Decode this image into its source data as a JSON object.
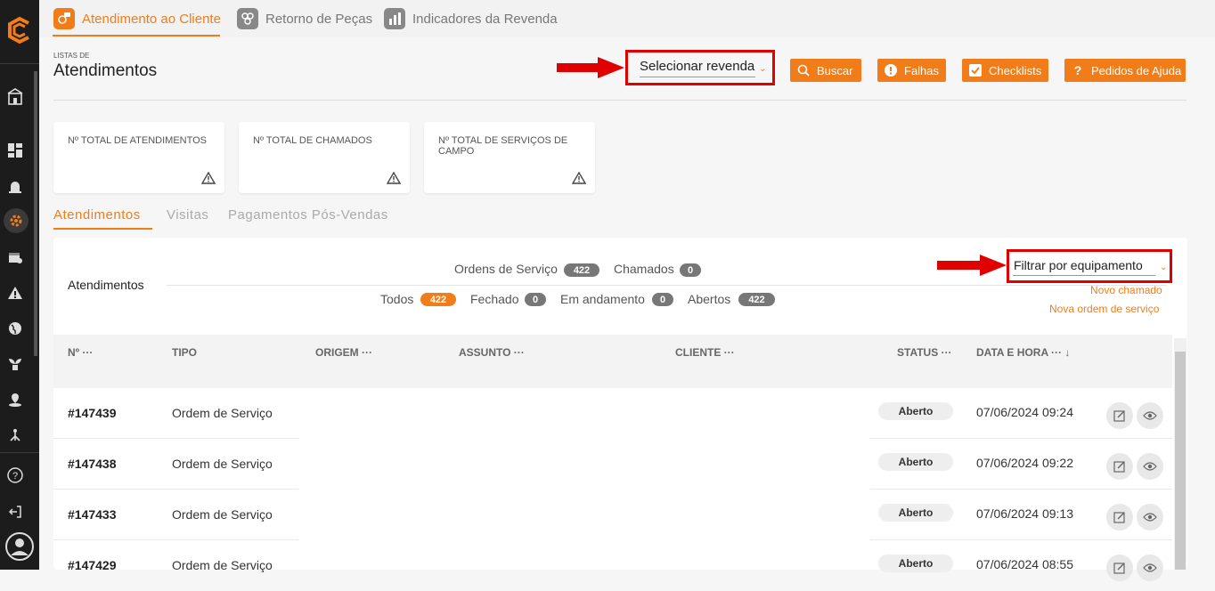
{
  "topnav": {
    "tabs": [
      {
        "label": "Atendimento ao Cliente",
        "active": true
      },
      {
        "label": "Retorno de Peças"
      },
      {
        "label": "Indicadores da Revenda"
      }
    ]
  },
  "header": {
    "small": "LISTAS DE",
    "title": "Atendimentos",
    "select_revenda": "Selecionar revenda",
    "buttons": {
      "buscar": "Buscar",
      "falhas": "Falhas",
      "checklists": "Checklists",
      "pedidos": "Pedidos de Ajuda"
    }
  },
  "cards": [
    {
      "label": "Nº TOTAL DE ATENDIMENTOS"
    },
    {
      "label": "Nº TOTAL DE CHAMADOS"
    },
    {
      "label": "Nº TOTAL DE SERVIÇOS DE CAMPO"
    }
  ],
  "subtabs": [
    "Atendimentos",
    "Visitas",
    "Pagamentos Pós-Vendas"
  ],
  "panel": {
    "title": "Atendimentos",
    "filters_top": [
      {
        "label": "Ordens de Serviço",
        "count": "422"
      },
      {
        "label": "Chamados",
        "count": "0"
      }
    ],
    "filters_bottom": [
      {
        "label": "Todos",
        "count": "422"
      },
      {
        "label": "Fechado",
        "count": "0"
      },
      {
        "label": "Em andamento",
        "count": "0"
      },
      {
        "label": "Abertos",
        "count": "422"
      }
    ],
    "filtrar_equipamento": "Filtrar por equipamento",
    "novo_chamado": "Novo chamado",
    "nova_ordem": "Nova ordem de serviço"
  },
  "table": {
    "columns": {
      "no": "Nº ···",
      "tipo": "TIPO",
      "origem": "ORIGEM ···",
      "assunto": "ASSUNTO ···",
      "cliente": "CLIENTE ···",
      "status": "STATUS ···",
      "data": "DATA E HORA ··· ↓"
    },
    "rows": [
      {
        "no": "#147439",
        "tipo": "Ordem de Serviço",
        "status": "Aberto",
        "data": "07/06/2024 09:24"
      },
      {
        "no": "#147438",
        "tipo": "Ordem de Serviço",
        "status": "Aberto",
        "data": "07/06/2024 09:22"
      },
      {
        "no": "#147433",
        "tipo": "Ordem de Serviço",
        "status": "Aberto",
        "data": "07/06/2024 09:13"
      },
      {
        "no": "#147429",
        "tipo": "Ordem de Serviço",
        "status": "Aberto",
        "data": "07/06/2024 08:55"
      }
    ]
  },
  "colors": {
    "accent": "#f07d1a",
    "annotation": "#e00000",
    "sidebar": "#1c1c1c"
  }
}
